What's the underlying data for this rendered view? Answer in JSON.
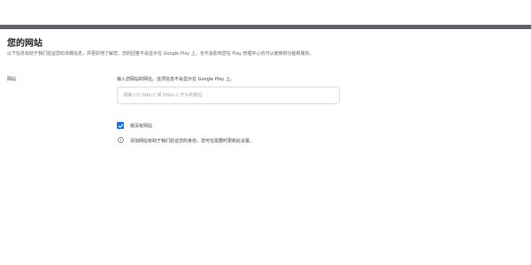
{
  "section": {
    "title": "您的网站",
    "description": "以下信息有助于我们验证您的详细信息，并更好地了解您。您的回答不会显示在 Google Play 上，也不会影响您在 Play 管理中心内可以使用的功能和服务。"
  },
  "website_field": {
    "label": "网站",
    "help_text": "输入您网站的网址。这项信息不会显示在 Google Play 上。",
    "placeholder": "请输入以 http:// 或 https:// 开头的网址",
    "value": ""
  },
  "no_website_checkbox": {
    "label": "我没有网站",
    "checked": true
  },
  "info": {
    "icon": "info-icon",
    "text": "添加网站有助于我们验证您的身份。您可在需要时更新此设置。"
  },
  "colors": {
    "accent": "#1a73e8",
    "top_bar": "#5f6368"
  }
}
